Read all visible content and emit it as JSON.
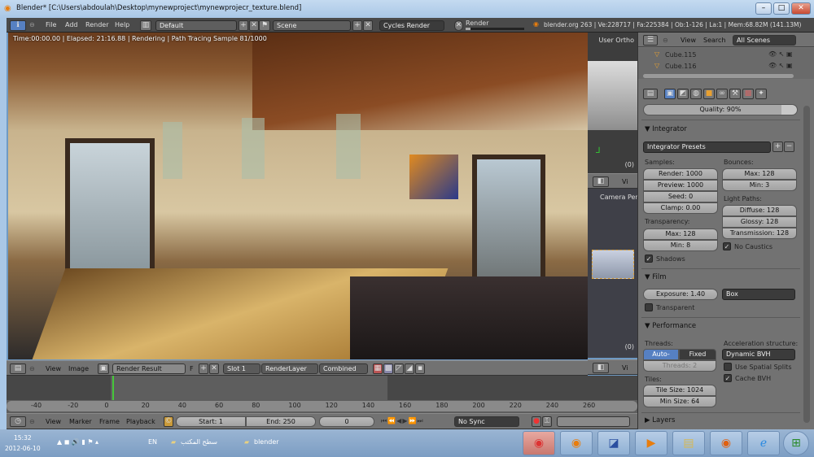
{
  "window": {
    "title": "Blender* [C:\\Users\\abdoulah\\Desktop\\mynewproject\\mynewprojecr_texture.blend]",
    "controls": [
      "–",
      "□",
      "✕"
    ]
  },
  "menubar": {
    "menus": [
      "File",
      "Add",
      "Render",
      "Help"
    ],
    "layout": "Default",
    "scene": "Scene",
    "engine": "Cycles Render",
    "render_progress_label": "Render",
    "stats": "blender.org 263 | Ve:228717 | Fa:225384 | Ob:1-126 | La:1 | Mem:68.82M (141.13M)"
  },
  "render_view": {
    "status": "Time:00:00.00 | Elapsed: 21:16.88 | Rendering | Path Tracing Sample 81/1000"
  },
  "viewports": [
    {
      "label": "User Ortho",
      "frame": "(0)"
    },
    {
      "label": "Camera Pers",
      "frame": "(0)"
    }
  ],
  "viewport_header": {
    "view": "Vi"
  },
  "image_editor_header": {
    "menus": [
      "View",
      "Image"
    ],
    "image": "Render Result",
    "fake_user": "F",
    "slot": "Slot 1",
    "layer": "RenderLayer",
    "pass": "Combined"
  },
  "timeline": {
    "ticks": [
      "-40",
      "-20",
      "0",
      "20",
      "40",
      "60",
      "80",
      "100",
      "120",
      "140",
      "160",
      "180",
      "200",
      "220",
      "240",
      "260"
    ],
    "current_frame": 0
  },
  "timeline_header": {
    "menus": [
      "View",
      "Marker",
      "Frame",
      "Playback"
    ],
    "start": "Start: 1",
    "end": "End: 250",
    "frame": "0",
    "sync": "No Sync"
  },
  "outliner": {
    "menus": [
      "View",
      "Search"
    ],
    "filter": "All Scenes",
    "items": [
      "Cube.115",
      "Cube.116"
    ]
  },
  "properties": {
    "quality": "Quality: 90%",
    "quality_value": 0.9,
    "integrator": {
      "title": "Integrator",
      "presets": "Integrator Presets",
      "samples_label": "Samples:",
      "render": "Render: 1000",
      "preview": "Preview: 1000",
      "seed": "Seed: 0",
      "clamp": "Clamp: 0.00",
      "bounces_label": "Bounces:",
      "max": "Max: 128",
      "min": "Min: 3",
      "light_paths_label": "Light Paths:",
      "diffuse": "Diffuse: 128",
      "glossy": "Glossy: 128",
      "transmission": "Transmission: 128",
      "transparency_label": "Transparency:",
      "t_max": "Max: 128",
      "t_min": "Min: 8",
      "no_caustics": "No Caustics",
      "no_caustics_checked": true,
      "shadows": "Shadows",
      "shadows_checked": true
    },
    "film": {
      "title": "Film",
      "exposure": "Exposure: 1.40",
      "filter": "Box",
      "transparent": "Transparent",
      "transparent_checked": false
    },
    "performance": {
      "title": "Performance",
      "threads_label": "Threads:",
      "auto": "Auto-detect",
      "fixed": "Fixed",
      "threads": "Threads: 2",
      "tiles_label": "Tiles:",
      "tile_size": "Tile Size: 1024",
      "min_size": "Min Size: 64",
      "accel_label": "Acceleration structure:",
      "accel": "Dynamic BVH",
      "spatial": "Use Spatial Splits",
      "spatial_checked": false,
      "cache": "Cache BVH",
      "cache_checked": true
    },
    "layers": {
      "title": "Layers"
    }
  },
  "taskbar": {
    "time": "15:32",
    "date": "2012-06-10",
    "lang": "EN",
    "desktop": "سطح المكتب",
    "folder": "blender",
    "apps": [
      "chrome",
      "blender",
      "messenger",
      "media-player",
      "explorer",
      "firefox",
      "internet-explorer",
      "start"
    ]
  },
  "colors": {
    "accent": "#5680c2",
    "timeline_cursor": "#46c73a"
  }
}
